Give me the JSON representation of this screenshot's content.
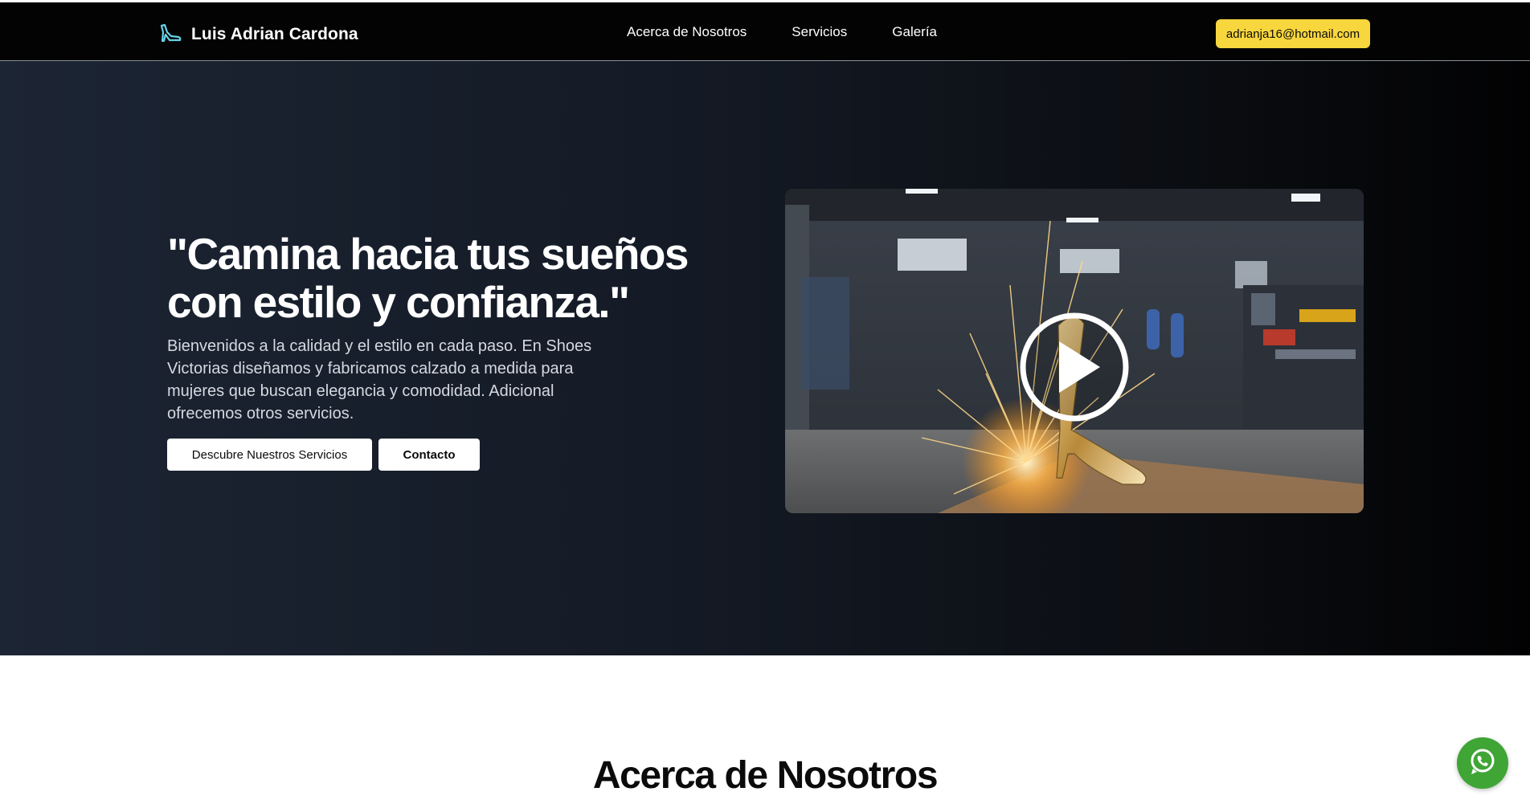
{
  "header": {
    "brand_name": "Luis Adrian Cardona",
    "brand_icon": "high-heel-icon",
    "nav": [
      {
        "label": "Acerca de Nosotros"
      },
      {
        "label": "Servicios"
      },
      {
        "label": "Galería"
      }
    ],
    "email": "adrianja16@hotmail.com"
  },
  "hero": {
    "title": "\"Camina hacia tus sueños con estilo y confianza.\"",
    "description": "Bienvenidos a la calidad y el estilo en cada paso. En Shoes Victorias diseñamos y fabricamos calzado a medida para mujeres que buscan elegancia y comodidad. Adicional ofrecemos otros servicios.",
    "primary_button": "Descubre Nuestros Servicios",
    "secondary_button": "Contacto",
    "video_icon": "play-icon"
  },
  "about": {
    "title": "Acerca de Nosotros"
  },
  "floating": {
    "icon": "whatsapp-icon"
  },
  "colors": {
    "accent": "#f8d63d",
    "whatsapp": "#3fa535",
    "header_bg": "#030303",
    "hero_bg": "#1c2534",
    "logo": "#67d3e8"
  }
}
